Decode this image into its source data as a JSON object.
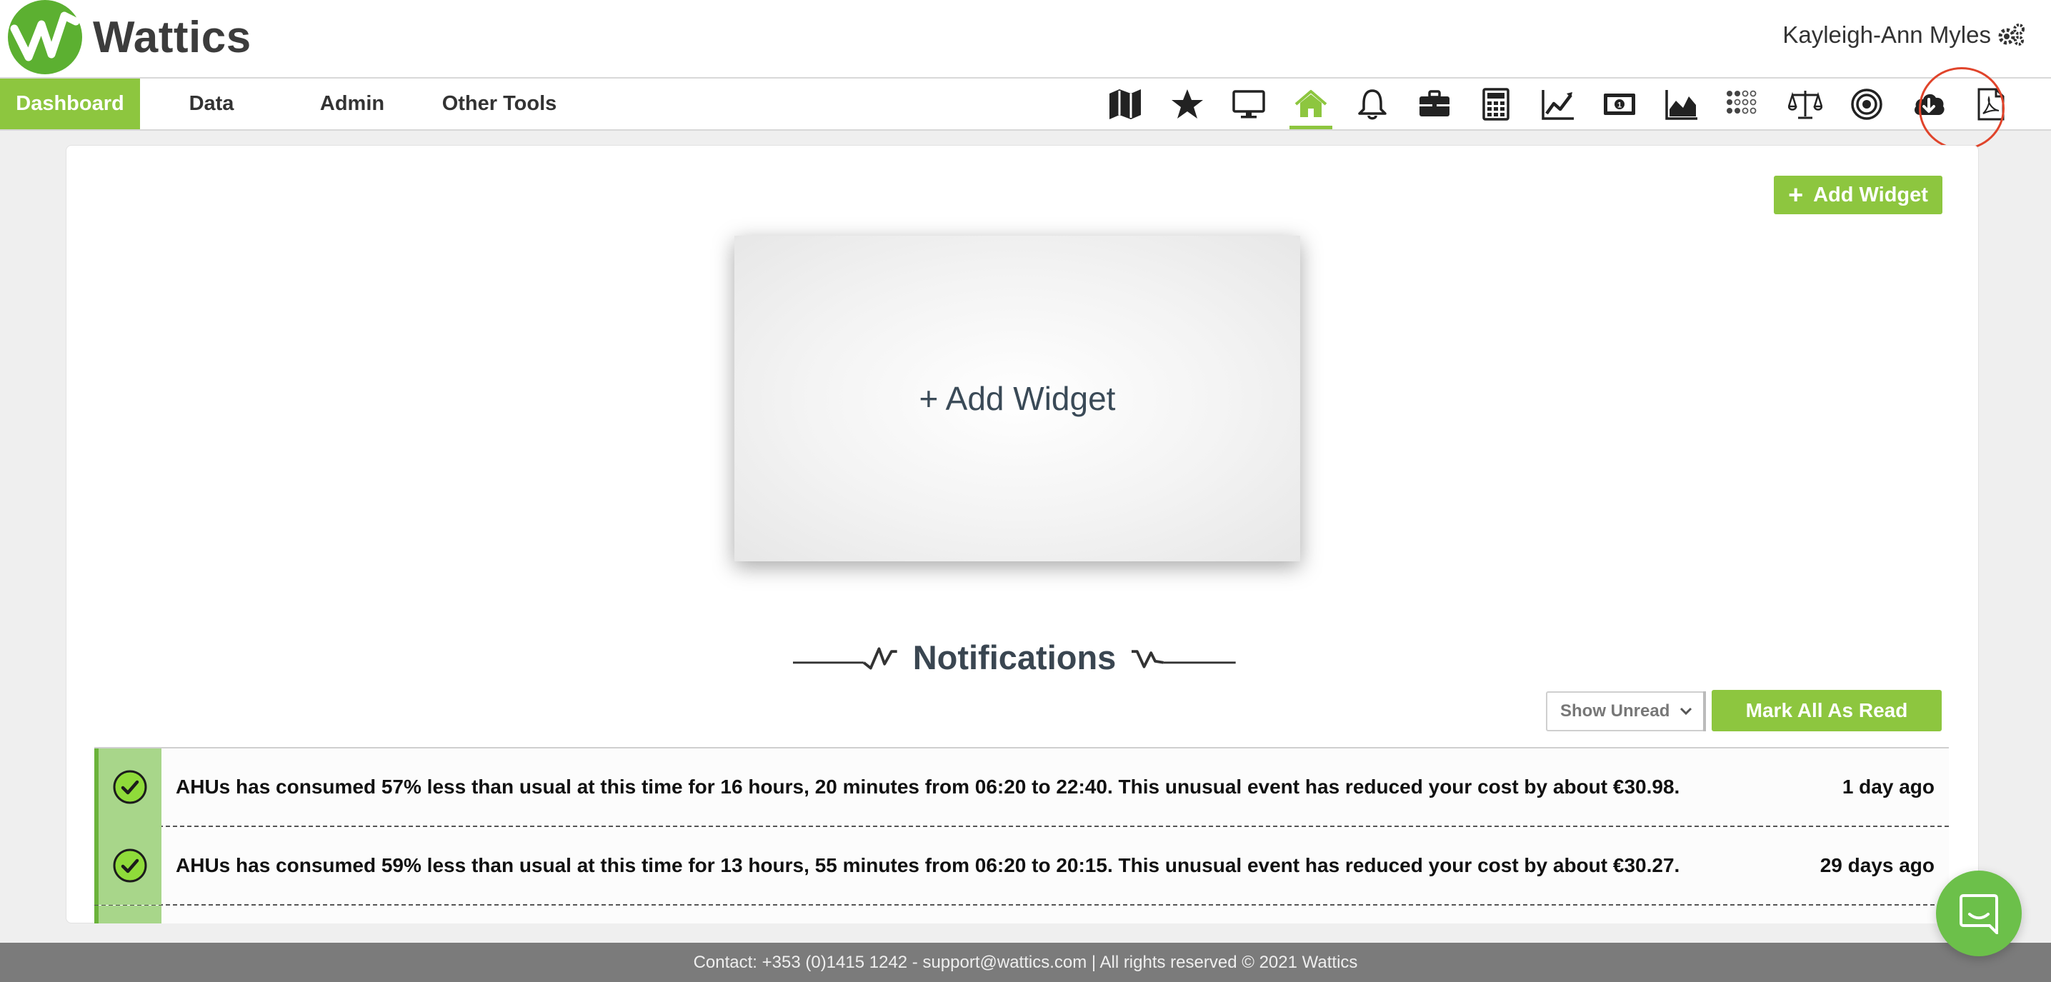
{
  "header": {
    "brand": "Wattics",
    "user_name": "Kayleigh-Ann Myles"
  },
  "nav": {
    "tabs": [
      {
        "label": "Dashboard",
        "active": true
      },
      {
        "label": "Data",
        "active": false
      },
      {
        "label": "Admin",
        "active": false
      },
      {
        "label": "Other Tools",
        "active": false
      }
    ],
    "icons": [
      {
        "name": "map-icon"
      },
      {
        "name": "star-icon"
      },
      {
        "name": "monitor-icon"
      },
      {
        "name": "home-icon",
        "active": true
      },
      {
        "name": "bell-icon"
      },
      {
        "name": "briefcase-icon"
      },
      {
        "name": "calculator-icon"
      },
      {
        "name": "line-chart-icon"
      },
      {
        "name": "money-icon"
      },
      {
        "name": "area-chart-icon"
      },
      {
        "name": "dots-grid-icon"
      },
      {
        "name": "balance-scale-icon"
      },
      {
        "name": "target-icon"
      },
      {
        "name": "cloud-download-icon",
        "highlighted": true
      },
      {
        "name": "pdf-icon"
      }
    ],
    "accent_color": "#8dc63f",
    "highlight_color": "#e0442b"
  },
  "main": {
    "add_widget_button": "Add Widget",
    "widget_placeholder": "+ Add Widget"
  },
  "notifications": {
    "heading": "Notifications",
    "filter_selected": "Show Unread",
    "mark_all_button": "Mark All As Read",
    "items": [
      {
        "message": "AHUs has consumed 57% less than usual at this time for 16 hours, 20 minutes from 06:20 to 22:40. This unusual event has reduced your cost by about €30.98.",
        "time": "1 day ago"
      },
      {
        "message": "AHUs has consumed 59% less than usual at this time for 13 hours, 55 minutes from 06:20 to 20:15. This unusual event has reduced your cost by about €30.27.",
        "time": "29 days ago"
      }
    ]
  },
  "footer": {
    "text": "Contact: +353 (0)1415 1242 - support@wattics.com | All rights reserved © 2021 Wattics"
  }
}
